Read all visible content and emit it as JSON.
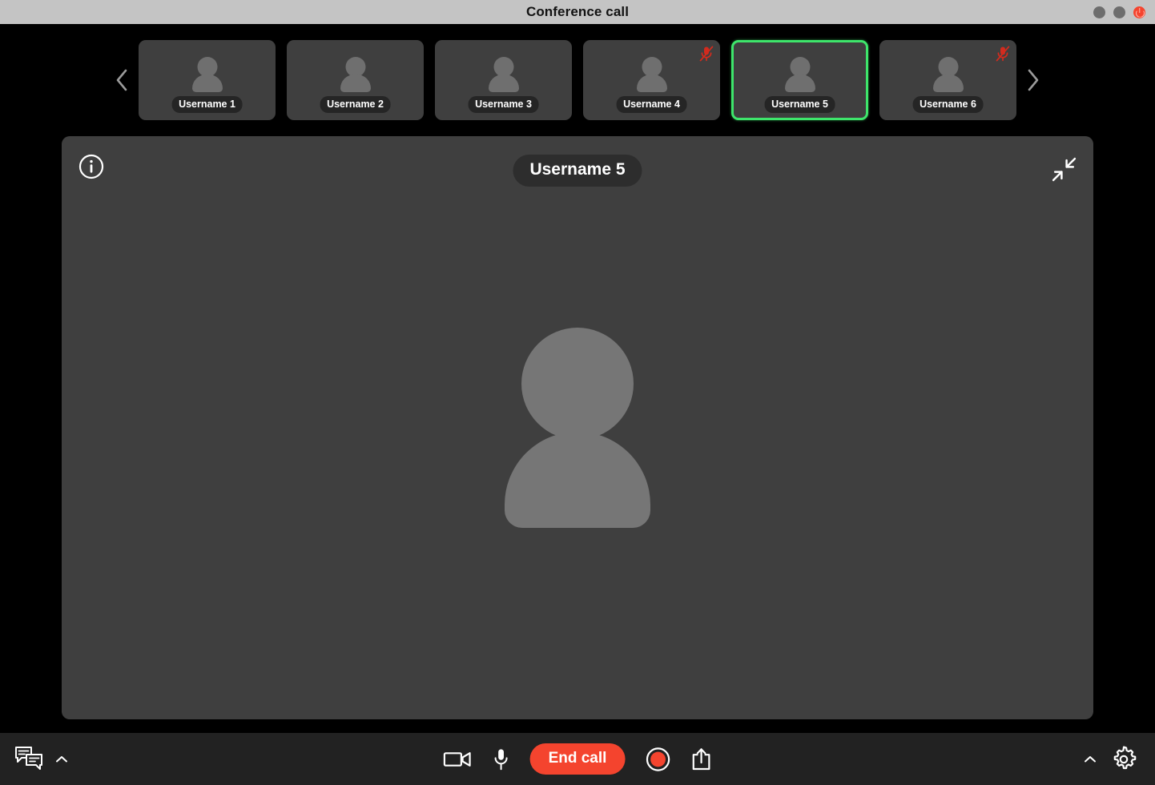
{
  "window": {
    "title": "Conference call",
    "controls": [
      {
        "name": "minimize-button",
        "color": "#6d6d6d"
      },
      {
        "name": "maximize-button",
        "color": "#6d6d6d"
      },
      {
        "name": "close-button",
        "color": "#f4442e"
      }
    ]
  },
  "filmstrip": {
    "prev_arrow": "chevron-left-icon",
    "next_arrow": "chevron-right-icon",
    "participants": [
      {
        "label": "Username 1",
        "muted": false,
        "selected": false
      },
      {
        "label": "Username 2",
        "muted": false,
        "selected": false
      },
      {
        "label": "Username 3",
        "muted": false,
        "selected": false
      },
      {
        "label": "Username 4",
        "muted": true,
        "selected": false
      },
      {
        "label": "Username 5",
        "muted": false,
        "selected": true
      },
      {
        "label": "Username 6",
        "muted": true,
        "selected": false
      }
    ]
  },
  "stage": {
    "info_icon": "info-icon",
    "active_speaker": "Username 5",
    "collapse_icon": "collapse-icon",
    "avatar": "placeholder-avatar"
  },
  "toolbar": {
    "chat_icon": "chat-icon",
    "chat_chevron": "chevron-up-icon",
    "camera_icon": "video-camera-icon",
    "microphone_icon": "microphone-icon",
    "end_call_label": "End call",
    "record_icon": "record-icon",
    "share_icon": "share-icon",
    "settings_chevron": "chevron-up-icon",
    "settings_icon": "gear-icon"
  },
  "colors": {
    "accent_green": "#3ee56b",
    "accent_red": "#f4442e",
    "panel": "#3f3f3f",
    "toolbar": "#222222",
    "titlebar": "#c4c4c4",
    "background": "#000000"
  }
}
